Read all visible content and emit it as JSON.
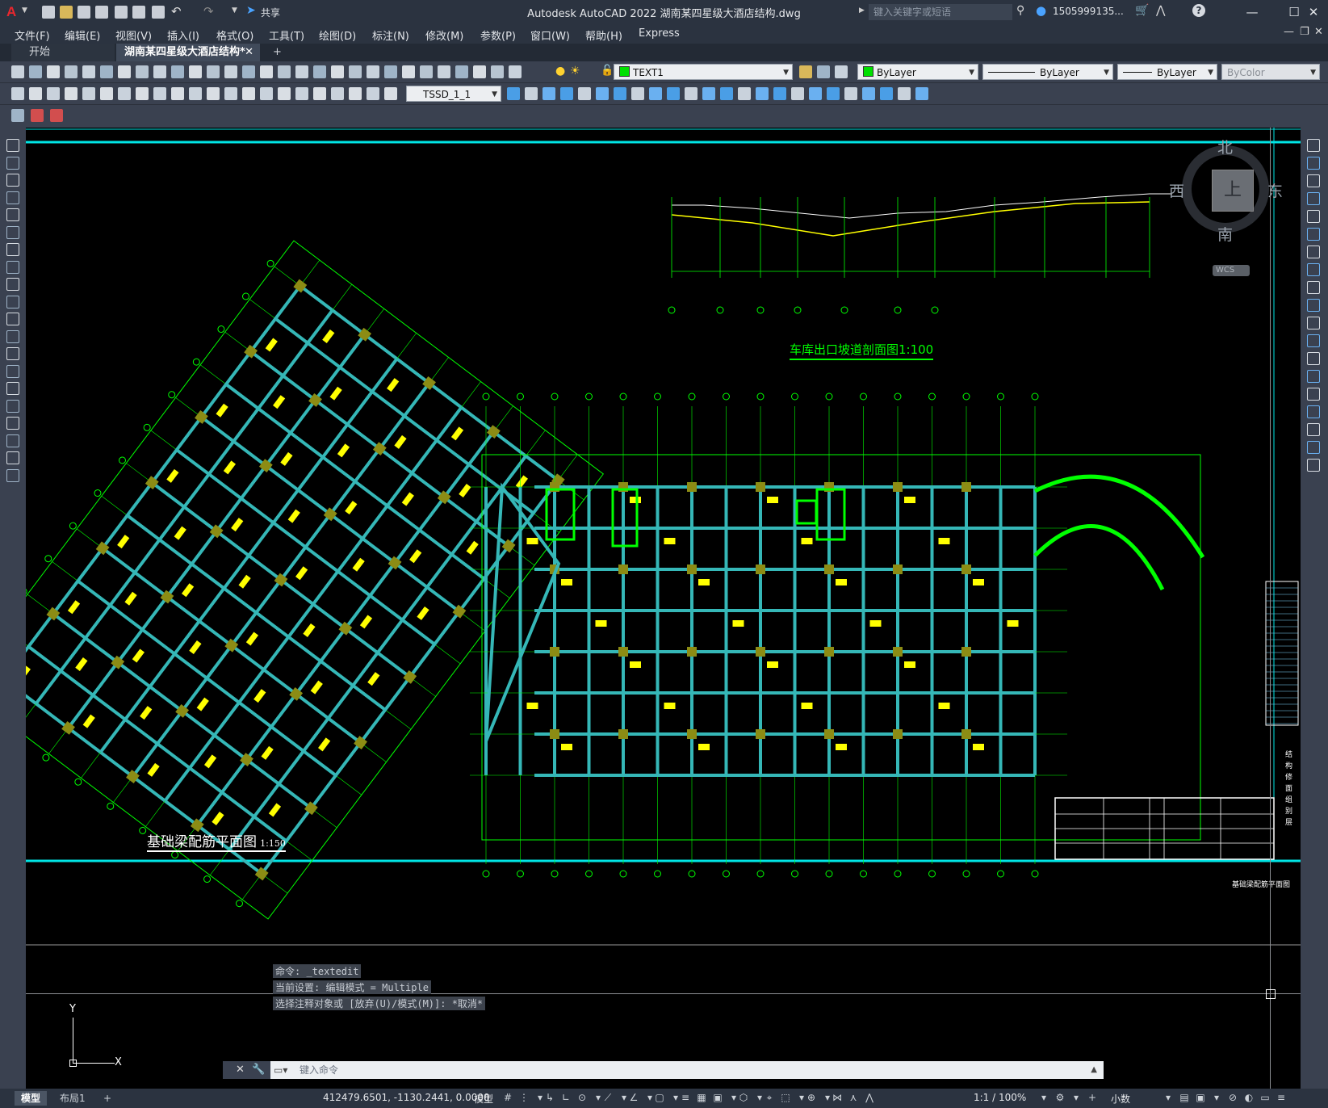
{
  "app": {
    "title": "Autodesk AutoCAD 2022    湖南某四星级大酒店结构.dwg",
    "logo_letter": "A",
    "share_label": "共享",
    "search_placeholder": "键入关键字或短语",
    "user_name": "1505999135...",
    "help_glyph": "?"
  },
  "menu": [
    "文件(F)",
    "编辑(E)",
    "视图(V)",
    "插入(I)",
    "格式(O)",
    "工具(T)",
    "绘图(D)",
    "标注(N)",
    "修改(M)",
    "参数(P)",
    "窗口(W)",
    "帮助(H)",
    "Express"
  ],
  "tabs": [
    {
      "label": "开始",
      "active": false
    },
    {
      "label": "湖南某四星级大酒店结构*",
      "active": true
    }
  ],
  "properties": {
    "layer": "TEXT1",
    "color": "ByLayer",
    "linetype": "ByLayer",
    "lineweight": "ByLayer",
    "plotstyle": "ByColor",
    "dimstyle": "TSSD_1_1"
  },
  "viewcube": {
    "north": "北",
    "south": "南",
    "east": "东",
    "west": "西",
    "face": "上",
    "ucs": "WCS"
  },
  "drawing": {
    "section_title": "车库出口坡道剖面图1:100",
    "plan_title": "基础梁配筋平面图",
    "plan_scale": "1:150",
    "title_block_name": "基础梁配筋平面图",
    "side_note": "结构修面\n组别层"
  },
  "ucs_icon": {
    "x_label": "X",
    "y_label": "Y"
  },
  "command": {
    "history": [
      "命令: _textedit",
      "当前设置: 编辑模式 = Multiple",
      "选择注释对象或 [放弃(U)/模式(M)]: *取消*"
    ],
    "input_placeholder": "键入命令"
  },
  "status": {
    "layouts": [
      "模型",
      "布局1"
    ],
    "coordinates": "412479.6501, -1130.2441, 0.0000",
    "space": "模型",
    "annotation_scale": "1:1 / 100%",
    "units": "小数"
  },
  "colors": {
    "canvas_bg": "#000000",
    "grid_line": "#00ff00",
    "beam": "#35b7b7",
    "label": "#ffff00",
    "border": "#00e5e5",
    "highlight": "#00ff00",
    "column": "#8c8c14"
  }
}
